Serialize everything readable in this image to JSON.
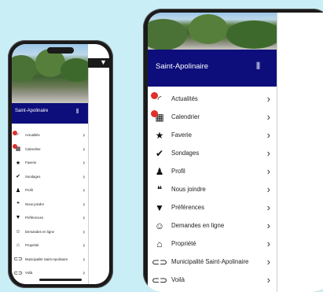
{
  "app": {
    "title": "Saint-Apolinaire",
    "accent": "#0d0e7c",
    "badge_color": "#e0302b"
  },
  "menu": {
    "items": [
      {
        "label": "Actualités",
        "icon": "rss-icon",
        "badge": true
      },
      {
        "label": "Calendrier",
        "icon": "calendar-icon",
        "badge": true
      },
      {
        "label": "Faverie",
        "icon": "star-icon",
        "badge": false
      },
      {
        "label": "Sondages",
        "icon": "check-circle-icon",
        "badge": false
      },
      {
        "label": "Profil",
        "icon": "person-icon",
        "badge": false
      },
      {
        "label": "Nous joindre",
        "icon": "chat-icon",
        "badge": false
      },
      {
        "label": "Préférences",
        "icon": "filter-icon",
        "badge": false
      },
      {
        "label": "Demandes en ligne",
        "icon": "smiley-icon",
        "badge": false
      },
      {
        "label": "Propriété",
        "icon": "house-circle-icon",
        "badge": false
      },
      {
        "label": "Municipalité Saint-Apolinaire",
        "icon": "link-icon",
        "badge": false
      },
      {
        "label": "Voilà",
        "icon": "link-icon",
        "badge": false
      }
    ]
  }
}
